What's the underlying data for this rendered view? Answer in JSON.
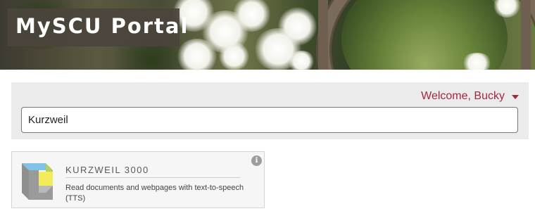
{
  "banner": {
    "title": "MySCU Portal"
  },
  "header": {
    "welcome_label": "Welcome, Bucky",
    "menu_icon": "caret-down-icon"
  },
  "search": {
    "value": "Kurzweil"
  },
  "results": [
    {
      "title": "KURZWEIL 3000",
      "description": "Read documents and webpages with text-to-speech (TTS)",
      "info_icon": "info-icon"
    }
  ],
  "colors": {
    "accent": "#a3283f",
    "panel_bg": "#ebebeb",
    "logo_bg": "#4b443c",
    "icon_blue": "#7fc3e8",
    "icon_yellow": "#f2eb5c",
    "icon_green": "#b5cf5a",
    "icon_gray": "#8f8f8f"
  }
}
